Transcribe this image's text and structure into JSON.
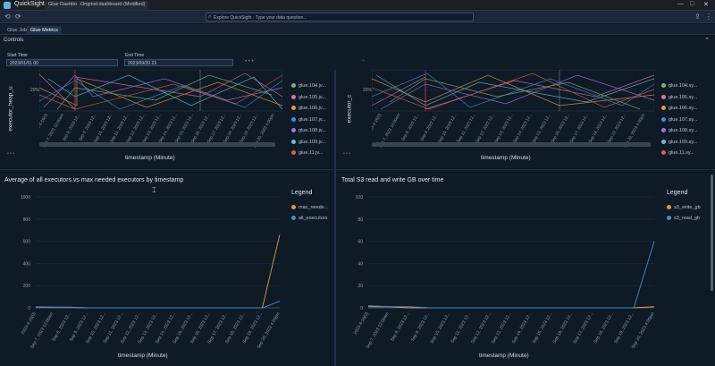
{
  "window": {
    "app_name": "QuickSight",
    "tabs": [
      "Glue Dashboard",
      "Original dashboard (Modified)"
    ],
    "controls": [
      "—",
      "□",
      "✕"
    ]
  },
  "address_bar": {
    "text": "Explore QuickSight · Type your data question..."
  },
  "sheet_tabs": [
    "Glue Jobs",
    "Glue Metrics"
  ],
  "controls": {
    "header": "Controls",
    "start_label": "Start Time",
    "start_value": "2023/01/01 00",
    "end_label": "End Time",
    "end_value": "2023/09/20 23"
  },
  "top_left": {
    "ylabel": "executor_heap_u",
    "xlabel": "timestamp (Minute)",
    "ytick": "20%",
    "legend": [
      {
        "label": "glue.104.jv...",
        "color": "#7fb26e"
      },
      {
        "label": "glue.105.jv...",
        "color": "#e36fa4"
      },
      {
        "label": "glue.106.jv...",
        "color": "#f09433"
      },
      {
        "label": "glue.107.jv...",
        "color": "#3f8fd6"
      },
      {
        "label": "glue.108.jv...",
        "color": "#a476d6"
      },
      {
        "label": "glue.109.jv...",
        "color": "#5ec2d2"
      },
      {
        "label": "glue.11.jv...",
        "color": "#e05a4f"
      }
    ]
  },
  "top_right": {
    "ylabel": "executor_c",
    "xlabel": "timestamp (Minute)",
    "ytick": "20%",
    "legend": [
      {
        "label": "glue.104.sy...",
        "color": "#7fb26e"
      },
      {
        "label": "glue.105.sy...",
        "color": "#e36fa4"
      },
      {
        "label": "glue.106.sy...",
        "color": "#f09433"
      },
      {
        "label": "glue.107.sy...",
        "color": "#3f8fd6"
      },
      {
        "label": "glue.108.sy...",
        "color": "#a476d6"
      },
      {
        "label": "glue.109.sy...",
        "color": "#5ec2d2"
      },
      {
        "label": "glue.11.sy...",
        "color": "#e05a4f"
      }
    ]
  },
  "x_ticks": [
    "2023-4-16(0)",
    "Sep 7, 2023 12:00am",
    "Sep 8, 2023 12...",
    "Sep 9, 2023 12...",
    "Sep 10, 2023 12...",
    "Sep 11, 2023 12...",
    "Sep 12, 2023 12...",
    "Sep 13, 2023 12...",
    "Sep 14, 2023 12...",
    "Sep 15, 2023 12...",
    "Sep 16, 2023 12...",
    "Sep 17, 2023 12...",
    "Sep 18, 2023 12...",
    "Sep 19, 2023 12...",
    "Sep 20, 2023 4:00pm"
  ],
  "chart_data": [
    {
      "type": "line",
      "title": "Average of all executors vs max needed executors by timestamp",
      "xlabel": "timestamp (Minute)",
      "ylim": [
        0,
        1000
      ],
      "yticks": [
        0,
        200,
        400,
        600,
        800,
        1000
      ],
      "legend_title": "Legend",
      "series": [
        {
          "name": "max_neede...",
          "color": "#f09433",
          "values": [
            8,
            6,
            5,
            0,
            0,
            0,
            0,
            0,
            0,
            0,
            0,
            0,
            0,
            0,
            660
          ]
        },
        {
          "name": "all_executors",
          "color": "#3f8fd6",
          "values": [
            5,
            4,
            3,
            0,
            0,
            0,
            0,
            0,
            0,
            0,
            0,
            0,
            0,
            0,
            60
          ]
        }
      ]
    },
    {
      "type": "line",
      "title": "Total S3 read and write GB over time",
      "xlabel": "timestamp (Minute)",
      "ylim": [
        0,
        100
      ],
      "yticks": [
        0,
        20,
        40,
        60,
        80,
        100
      ],
      "legend_title": "Legend",
      "series": [
        {
          "name": "s3_write_gb",
          "color": "#f09433",
          "values": [
            1,
            1,
            0,
            0,
            0,
            0,
            0,
            0,
            0,
            0,
            0,
            0,
            0,
            0,
            1
          ]
        },
        {
          "name": "s3_read_gb",
          "color": "#3f8fd6",
          "values": [
            2,
            1,
            1,
            0,
            0,
            0,
            0,
            0,
            0,
            0,
            0,
            0,
            0,
            0,
            60
          ]
        }
      ]
    }
  ]
}
